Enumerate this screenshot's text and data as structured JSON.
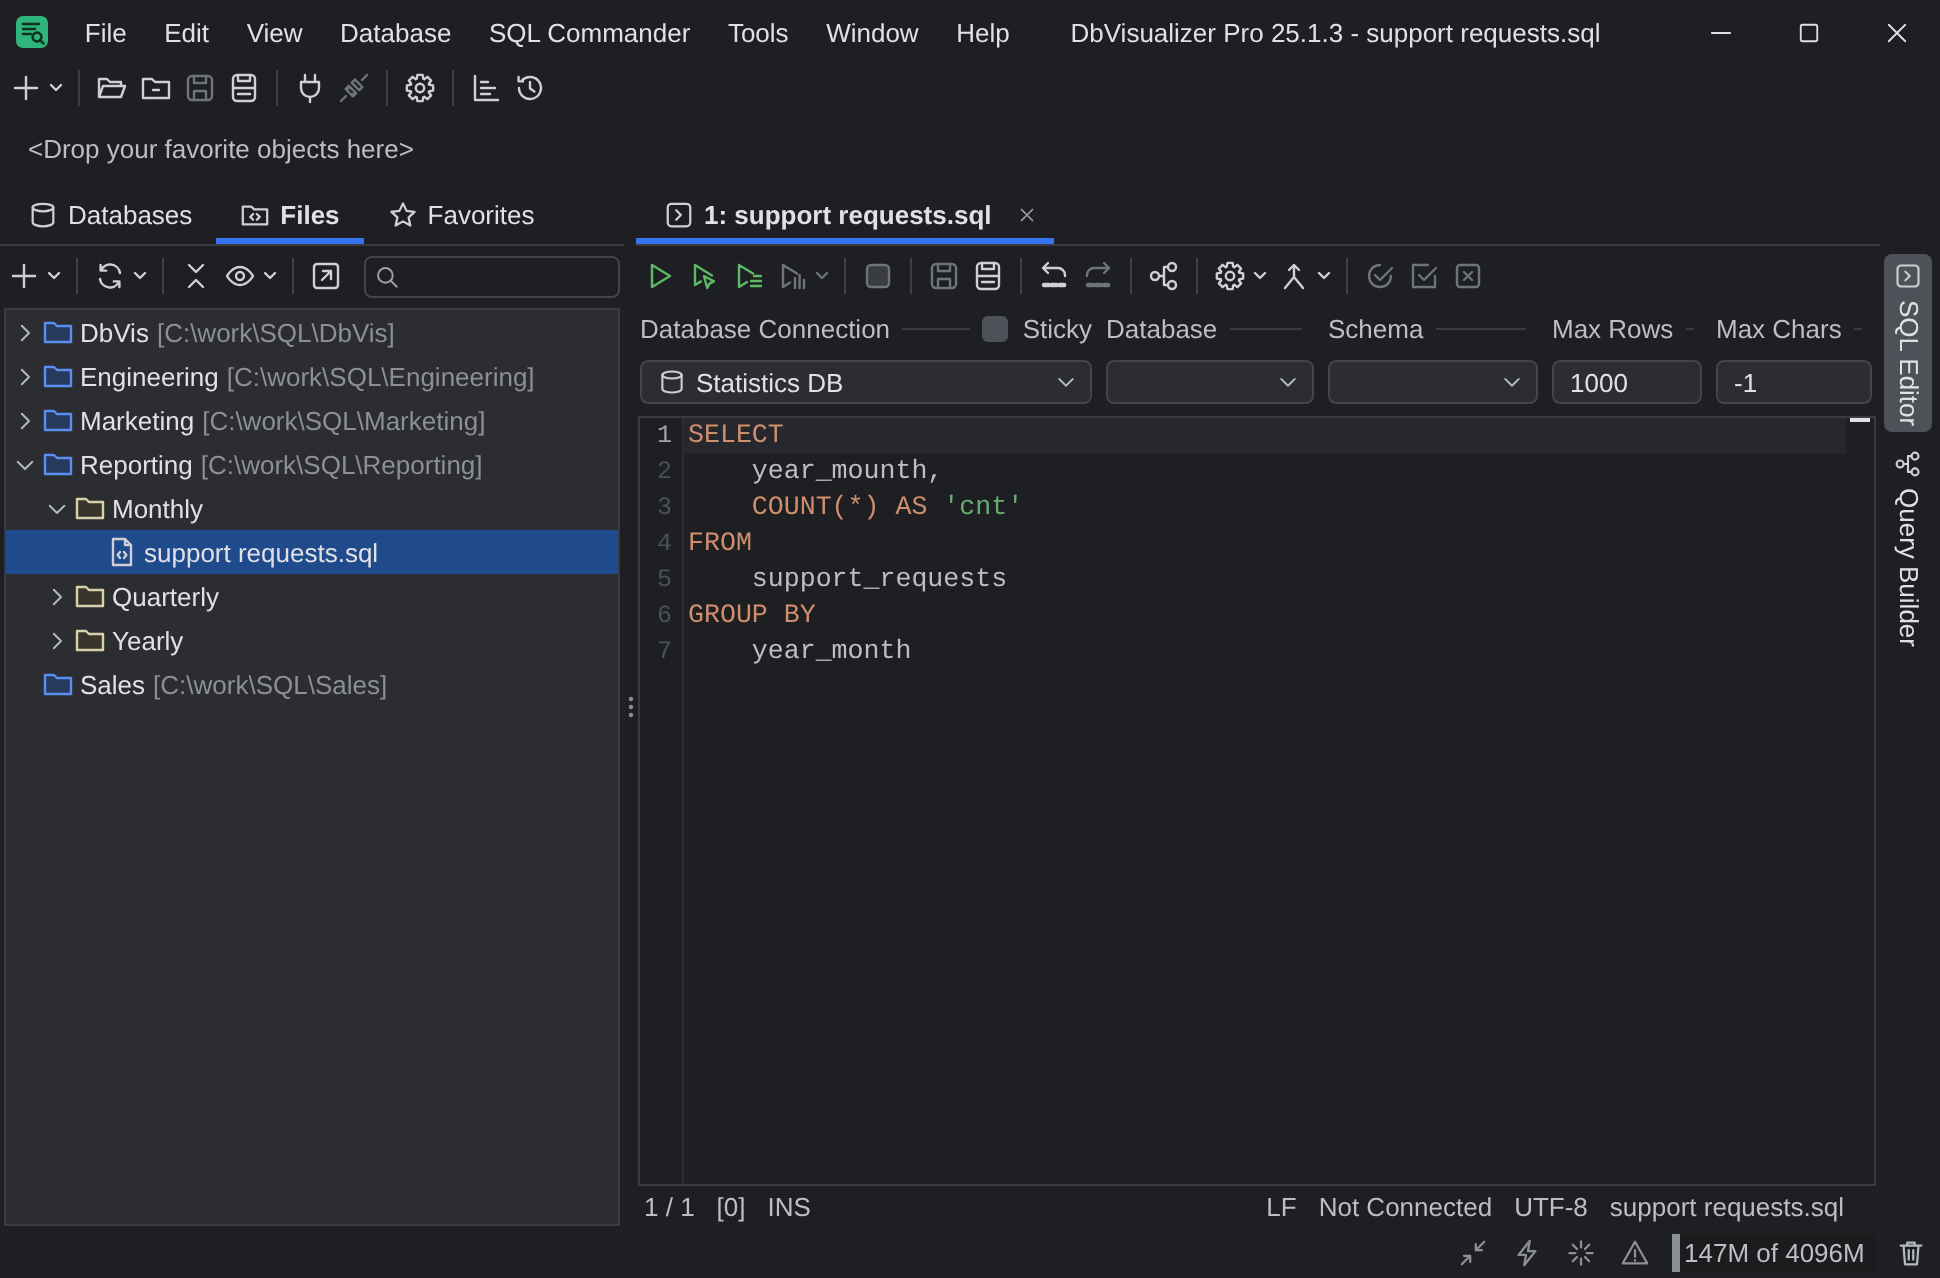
{
  "window": {
    "title": "DbVisualizer Pro 25.1.3 - support requests.sql"
  },
  "menu": [
    "File",
    "Edit",
    "View",
    "Database",
    "SQL Commander",
    "Tools",
    "Window",
    "Help"
  ],
  "main_toolbar": [
    [
      {
        "kind": "plus",
        "disabled": false
      },
      {
        "kind": "caret",
        "disabled": false
      }
    ],
    [
      {
        "kind": "folder-open",
        "disabled": false
      },
      {
        "kind": "folder",
        "disabled": false
      },
      {
        "kind": "save",
        "disabled": true
      },
      {
        "kind": "save-all",
        "disabled": false
      }
    ],
    [
      {
        "kind": "plug",
        "disabled": false
      },
      {
        "kind": "unplug",
        "disabled": true
      }
    ],
    [
      {
        "kind": "gear",
        "disabled": false
      }
    ],
    [
      {
        "kind": "bar-chart",
        "disabled": false
      },
      {
        "kind": "history",
        "disabled": false
      }
    ]
  ],
  "favorites_bar": {
    "hint": "<Drop your favorite objects here>"
  },
  "side_tabs": [
    {
      "label": "Databases",
      "kind": "database",
      "selected": false
    },
    {
      "label": "Files",
      "kind": "folder-code",
      "selected": true
    },
    {
      "label": "Favorites",
      "kind": "star",
      "selected": false
    }
  ],
  "files_toolbar": [
    [
      {
        "kind": "plus",
        "disabled": false
      },
      {
        "kind": "caret",
        "disabled": false
      }
    ],
    [
      {
        "kind": "refresh",
        "disabled": false
      },
      {
        "kind": "caret",
        "disabled": false
      }
    ],
    [
      {
        "kind": "collapse",
        "disabled": false
      },
      {
        "kind": "eye",
        "disabled": false
      },
      {
        "kind": "caret",
        "disabled": false
      }
    ],
    [
      {
        "kind": "external-link",
        "disabled": false
      }
    ]
  ],
  "tree": [
    {
      "name": "DbVis",
      "path": "[C:\\work\\SQL\\DbVis]",
      "kind": "root",
      "expanded": false,
      "selected": false
    },
    {
      "name": "Engineering",
      "path": "[C:\\work\\SQL\\Engineering]",
      "kind": "root",
      "expanded": false,
      "selected": false
    },
    {
      "name": "Marketing",
      "path": "[C:\\work\\SQL\\Marketing]",
      "kind": "root",
      "expanded": false,
      "selected": false
    },
    {
      "name": "Reporting",
      "path": "[C:\\work\\SQL\\Reporting]",
      "kind": "root",
      "expanded": true,
      "selected": false,
      "children": [
        {
          "name": "Monthly",
          "kind": "folder",
          "expanded": true,
          "selected": false,
          "children": [
            {
              "name": "support requests.sql",
              "kind": "file",
              "selected": true
            }
          ]
        },
        {
          "name": "Quarterly",
          "kind": "folder",
          "expanded": false,
          "selected": false
        },
        {
          "name": "Yearly",
          "kind": "folder",
          "expanded": false,
          "selected": false
        }
      ]
    },
    {
      "name": "Sales",
      "path": "[C:\\work\\SQL\\Sales]",
      "kind": "root",
      "selected": false
    }
  ],
  "editor_tabs": [
    {
      "label": "1: support requests.sql",
      "selected": true
    }
  ],
  "editor_toolbar": [
    [
      {
        "kind": "run",
        "disabled": false
      },
      {
        "kind": "run-pointer",
        "disabled": false
      },
      {
        "kind": "run-lines",
        "disabled": false
      },
      {
        "kind": "run-chart",
        "disabled": true
      },
      {
        "kind": "caret",
        "disabled": true
      }
    ],
    [
      {
        "kind": "stop",
        "disabled": true
      }
    ],
    [
      {
        "kind": "save",
        "disabled": true
      },
      {
        "kind": "save-all",
        "disabled": false
      }
    ],
    [
      {
        "kind": "undo-sql",
        "disabled": false
      },
      {
        "kind": "redo-sql",
        "disabled": true
      }
    ],
    [
      {
        "kind": "nodes",
        "disabled": false
      }
    ],
    [
      {
        "kind": "gear",
        "disabled": false
      },
      {
        "kind": "caret",
        "disabled": false
      },
      {
        "kind": "branch",
        "disabled": false
      },
      {
        "kind": "caret",
        "disabled": false
      }
    ],
    [
      {
        "kind": "check-circle",
        "disabled": true
      },
      {
        "kind": "check-square",
        "disabled": true
      },
      {
        "kind": "x-square",
        "disabled": true
      }
    ]
  ],
  "connection_form": {
    "sticky": {
      "label": "Sticky",
      "checked": false
    },
    "fields": [
      {
        "label": "Database Connection",
        "kind": "connection",
        "value": "Statistics DB"
      },
      {
        "label": "Database",
        "kind": "select"
      },
      {
        "label": "Schema",
        "kind": "select"
      },
      {
        "label": "Max Rows",
        "kind": "input",
        "value": "1000"
      },
      {
        "label": "Max Chars",
        "kind": "input",
        "value": "-1"
      }
    ]
  },
  "editor": {
    "lines": [
      {
        "number": "1",
        "current": true,
        "indented": false,
        "tokens": [
          {
            "text": "SELECT",
            "kind": "keyword"
          }
        ]
      },
      {
        "number": "2",
        "current": false,
        "indented": true,
        "tokens": [
          {
            "text": "year_mounth,",
            "kind": "identifier"
          }
        ]
      },
      {
        "number": "3",
        "current": false,
        "indented": true,
        "tokens": [
          {
            "text": "COUNT(*)",
            "kind": "keyword"
          },
          {
            "text": "AS",
            "kind": "keyword"
          },
          {
            "text": "'cnt'",
            "kind": "string"
          }
        ]
      },
      {
        "number": "4",
        "current": false,
        "indented": false,
        "tokens": [
          {
            "text": "FROM",
            "kind": "keyword"
          }
        ]
      },
      {
        "number": "5",
        "current": false,
        "indented": true,
        "tokens": [
          {
            "text": "support_requests",
            "kind": "identifier"
          }
        ]
      },
      {
        "number": "6",
        "current": false,
        "indented": false,
        "tokens": [
          {
            "text": "GROUP BY",
            "kind": "keyword"
          }
        ]
      },
      {
        "number": "7",
        "current": false,
        "indented": true,
        "tokens": [
          {
            "text": "year_month",
            "kind": "identifier"
          }
        ]
      }
    ]
  },
  "editor_status": {
    "left": [
      "1 / 1",
      "[0]",
      "INS"
    ],
    "right": [
      "LF",
      "Not Connected",
      "UTF-8",
      "support requests.sql"
    ]
  },
  "tool_windows": [
    {
      "label": "SQL Editor",
      "kind": "terminal",
      "selected": true
    },
    {
      "label": "Query Builder",
      "kind": "nodes",
      "selected": false
    }
  ],
  "status_bar": {
    "memory": {
      "label": "147M of 4096M",
      "level": 0.04
    }
  }
}
